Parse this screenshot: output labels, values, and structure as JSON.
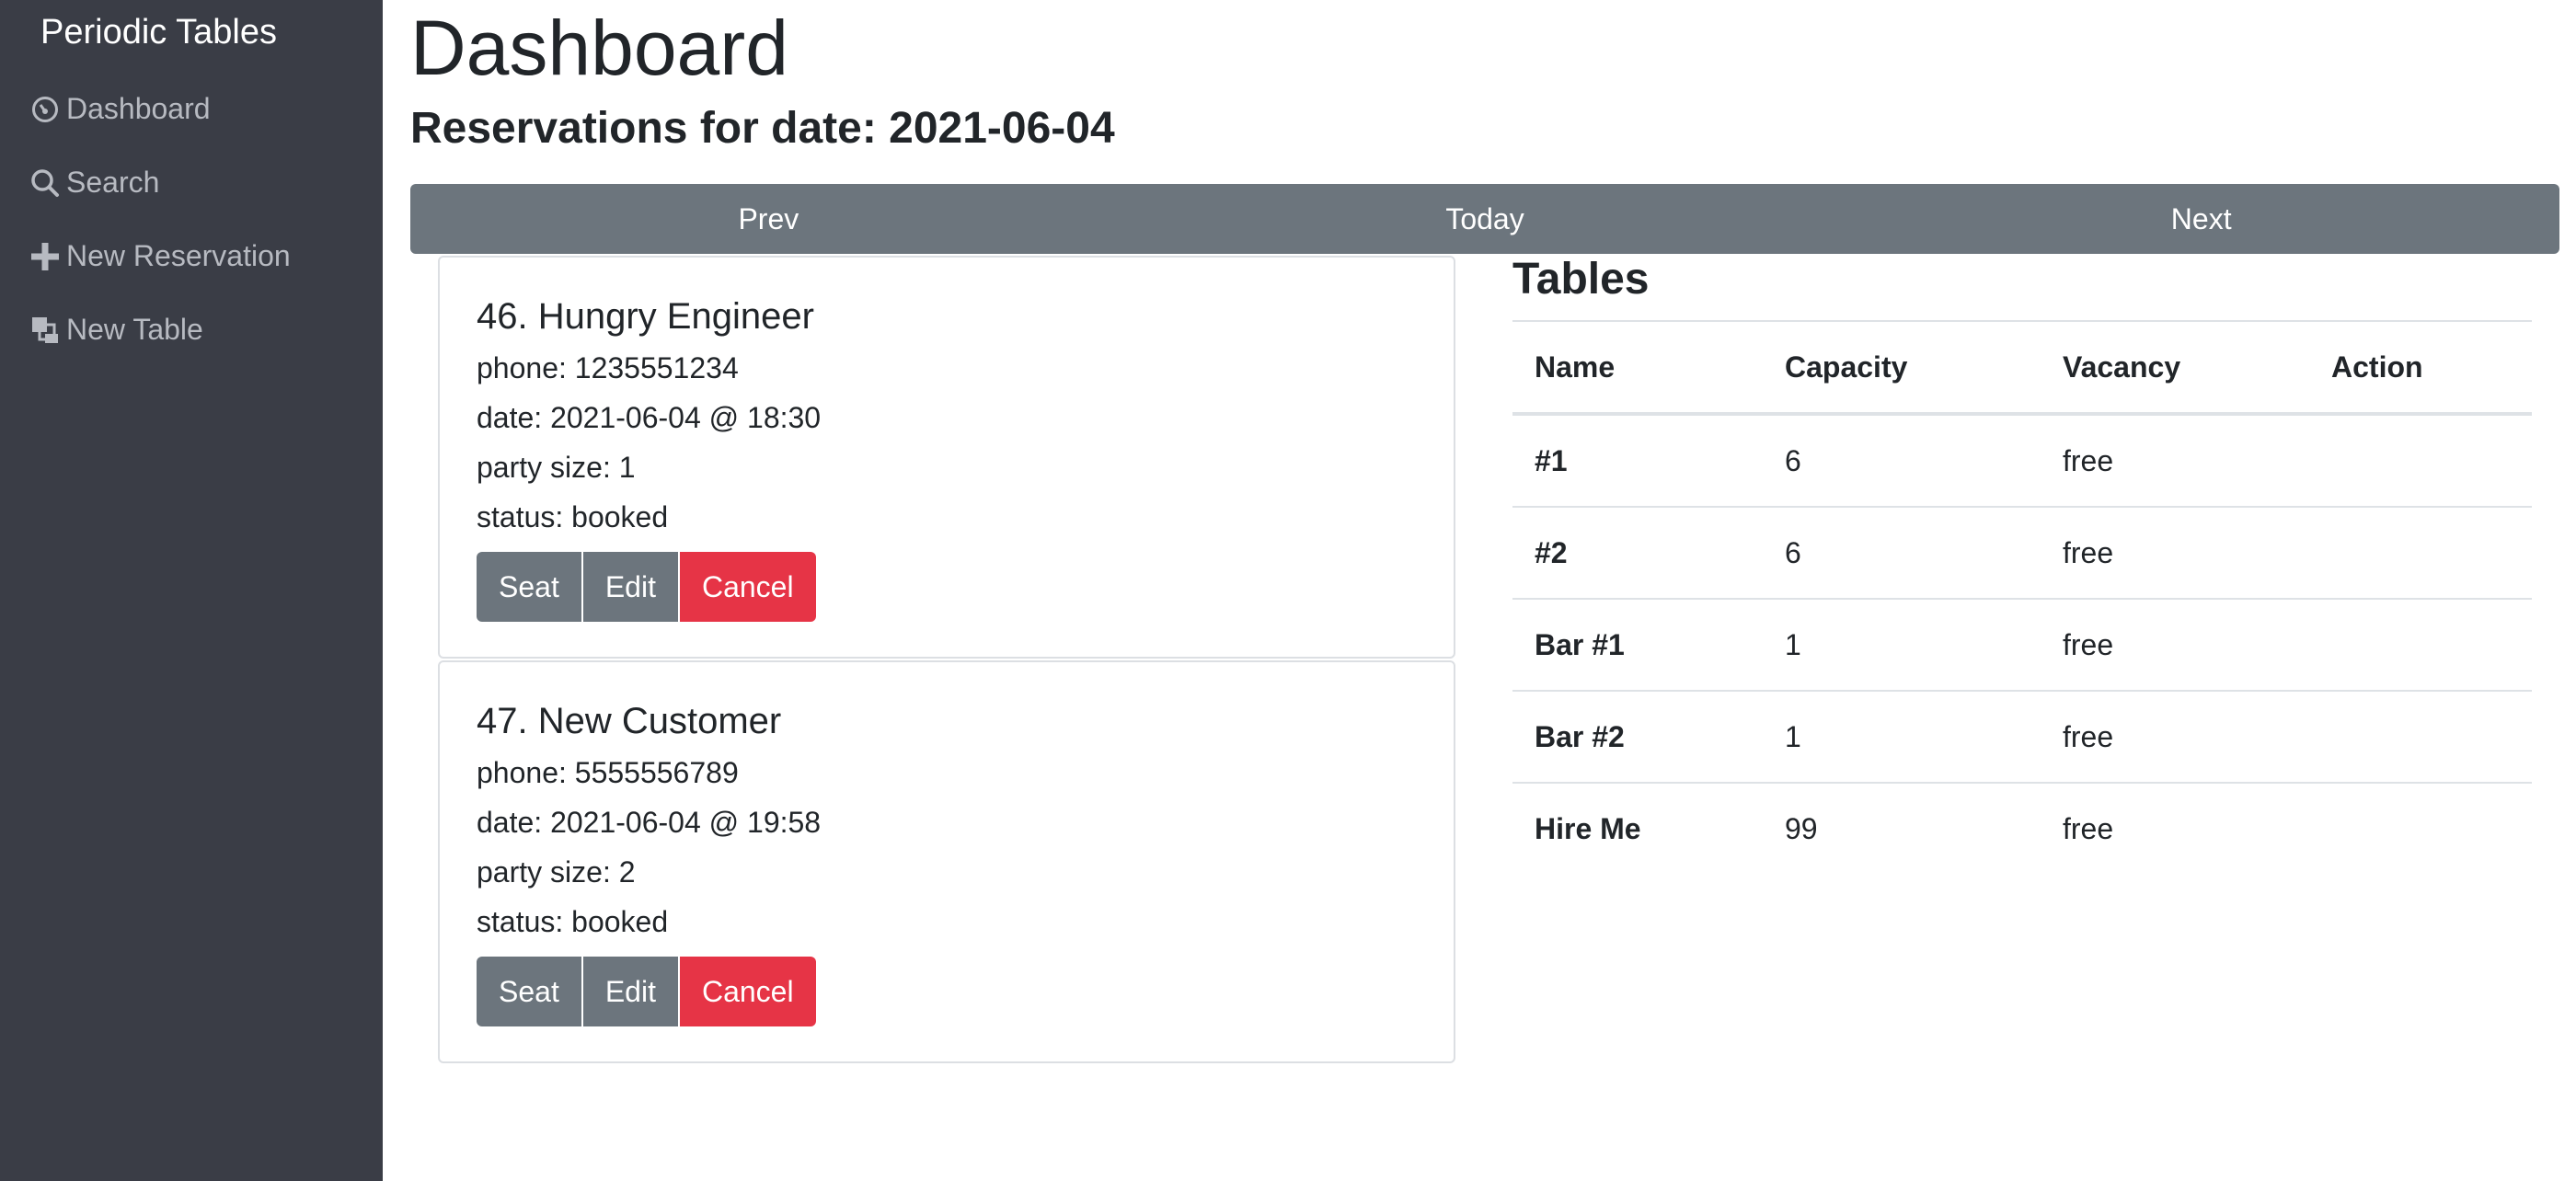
{
  "sidebar": {
    "brand": "Periodic Tables",
    "items": [
      {
        "label": "Dashboard",
        "icon": "dashboard-icon"
      },
      {
        "label": "Search",
        "icon": "search-icon"
      },
      {
        "label": "New Reservation",
        "icon": "plus-icon"
      },
      {
        "label": "New Table",
        "icon": "layers-icon"
      }
    ]
  },
  "header": {
    "title": "Dashboard",
    "subtitle": "Reservations for date: 2021-06-04"
  },
  "datebar": {
    "prev": "Prev",
    "today": "Today",
    "next": "Next"
  },
  "reservations": [
    {
      "title": "46. Hungry Engineer",
      "phone": "phone: 1235551234",
      "date": "date: 2021-06-04 @ 18:30",
      "party": "party size: 1",
      "status": "status: booked",
      "seat_label": "Seat",
      "edit_label": "Edit",
      "cancel_label": "Cancel"
    },
    {
      "title": "47. New Customer",
      "phone": "phone: 5555556789",
      "date": "date: 2021-06-04 @ 19:58",
      "party": "party size: 2",
      "status": "status: booked",
      "seat_label": "Seat",
      "edit_label": "Edit",
      "cancel_label": "Cancel"
    }
  ],
  "tables": {
    "heading": "Tables",
    "columns": [
      "Name",
      "Capacity",
      "Vacancy",
      "Action"
    ],
    "rows": [
      {
        "name": "#1",
        "capacity": "6",
        "vacancy": "free",
        "action": ""
      },
      {
        "name": "#2",
        "capacity": "6",
        "vacancy": "free",
        "action": ""
      },
      {
        "name": "Bar #1",
        "capacity": "1",
        "vacancy": "free",
        "action": ""
      },
      {
        "name": "Bar #2",
        "capacity": "1",
        "vacancy": "free",
        "action": ""
      },
      {
        "name": "Hire Me",
        "capacity": "99",
        "vacancy": "free",
        "action": ""
      }
    ]
  },
  "colors": {
    "sidebar_bg": "#3a3d46",
    "nav_text": "#b7bac1",
    "secondary": "#6c757d",
    "danger": "#e63446"
  }
}
